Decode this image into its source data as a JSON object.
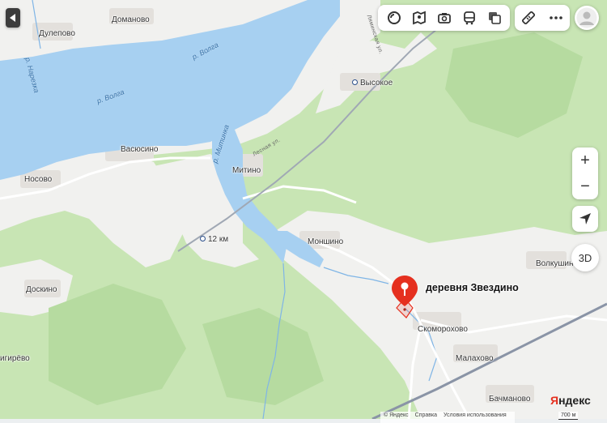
{
  "controls": {
    "back_button_icon": "triangle-left-icon",
    "toolbar_layers": [
      {
        "name": "layers-icon"
      },
      {
        "name": "panorama-icon"
      },
      {
        "name": "photo-camera-icon"
      },
      {
        "name": "bus-icon"
      },
      {
        "name": "map-stack-icon"
      }
    ],
    "toolbar_tools": [
      {
        "name": "ruler-icon"
      },
      {
        "name": "more-dots-icon"
      }
    ],
    "avatar": "user-avatar-icon",
    "zoom_in": "+",
    "zoom_out": "−",
    "three_d": "3D"
  },
  "places": {
    "dulepovo": "Дулепово",
    "domanovo": "Доманово",
    "vysokoe": "Высокое",
    "vasyusino": "Васюсино",
    "nosovo": "Носово",
    "mitino": "Митино",
    "km12": "12 км",
    "monshino": "Моншино",
    "doskino": "Доскино",
    "volkushino": "Волкушин",
    "skomorokhovo": "Скоморохово",
    "malakhovo": "Малахово",
    "bachmanovo": "Бачманово",
    "igirevo": "игирёво"
  },
  "rivers": {
    "volga1": "р. Волга",
    "volga2": "р. Волга",
    "narezka": "р. Нарезка",
    "mitinka": "р. Митинка"
  },
  "streets": {
    "lesnaya": "Лесная ул.",
    "lyaminskaya": "Ляминская ул."
  },
  "marker": {
    "label": "деревня Звездино",
    "color": "#e5301f"
  },
  "footer": {
    "copyright": "© Яндекс",
    "help": "Справка",
    "terms": "Условия использования",
    "scale": "700 м"
  },
  "logo": {
    "first": "Я",
    "rest": "ндекс"
  },
  "colors": {
    "water": "#a7d0f1",
    "forest": "#c8e5b4",
    "open_land": "#f1f1ef",
    "settlement": "#e6e3e0",
    "railway": "#8a94a6"
  }
}
